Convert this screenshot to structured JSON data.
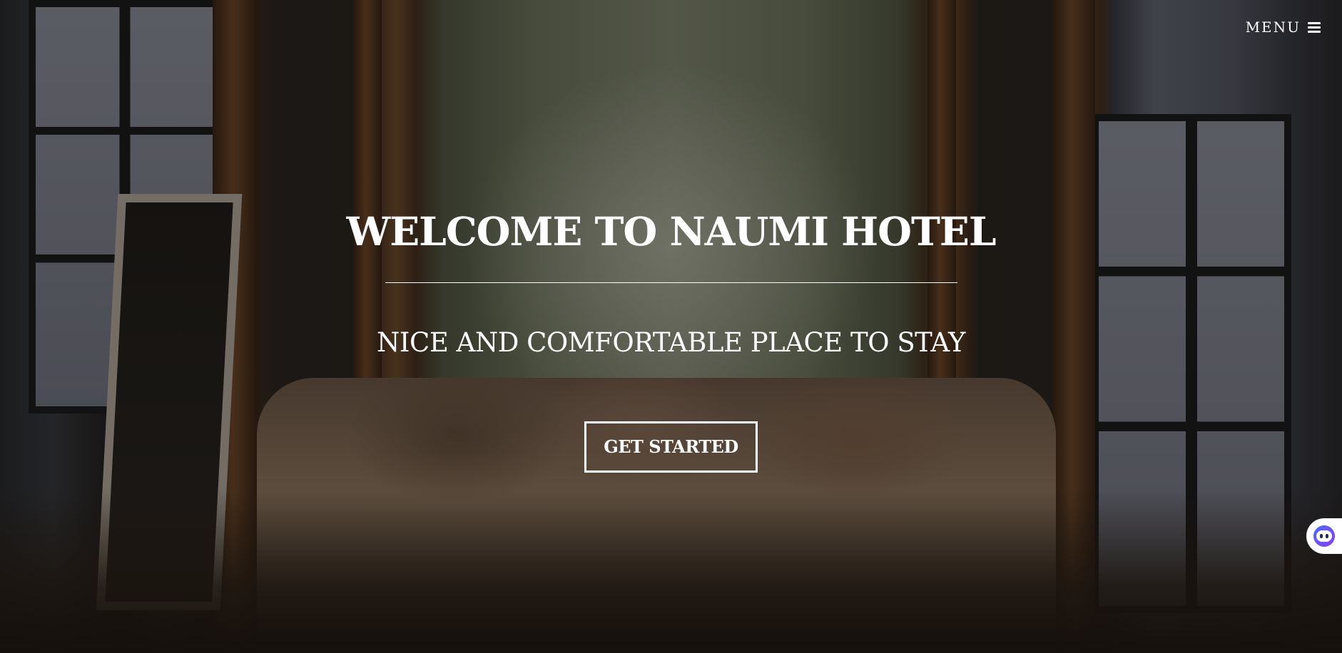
{
  "header": {
    "menu_label": "MENU",
    "menu_icon": "hamburger-icon"
  },
  "hero": {
    "title": "WELCOME TO NAUMI HOTEL",
    "subtitle": "NICE AND COMFORTABLE PLACE TO STAY",
    "cta_label": "GET STARTED",
    "background_image": "hotel room with canopy bed, fur pillows and backlit frosted plant wall"
  },
  "chat_widget": {
    "icon": "chatbot-face-icon"
  },
  "colors": {
    "text": "#ffffff",
    "overlay": "rgba(12,9,7,0.45)",
    "chat_gradient_start": "#4a6cf7",
    "chat_gradient_end": "#8b3cf0"
  }
}
